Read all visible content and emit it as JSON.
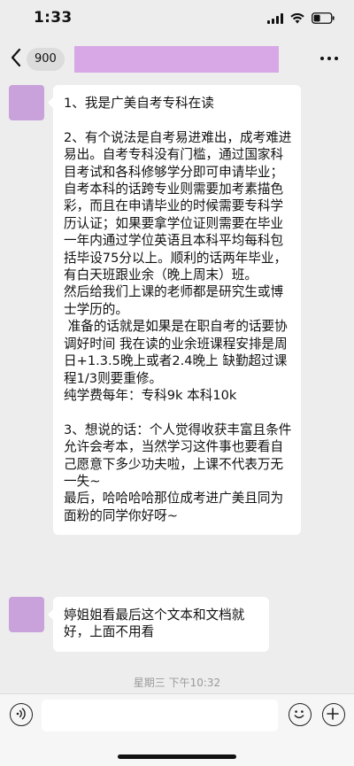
{
  "status_bar": {
    "time": "1:33",
    "icons": [
      "cellular-signal-icon",
      "wifi-icon",
      "battery-icon"
    ]
  },
  "header": {
    "back_icon": "chevron-left-icon",
    "unread_count": "900",
    "title_redacted_color": "#d8a8e6",
    "more_icon": "ellipsis-icon"
  },
  "colors": {
    "background": "#ededed",
    "bubble": "#ffffff",
    "avatar": "#c9a2dc",
    "timestamp_text": "#9a9a9a"
  },
  "messages": [
    {
      "sender": "other",
      "text": "1、我是广美自考专科在读\n\n2、有个说法是自考易进难出，成考难进易出。自考专科没有门槛，通过国家科目考试和各科修够学分即可申请毕业；自考本科的话跨专业则需要加考素描色彩，而且在申请毕业的时候需要专科学历认证；如果要拿学位证则需要在毕业一年内通过学位英语且本科平均每科包括毕设75分以上。顺利的话两年毕业，有白天班跟业余（晚上周末）班。\n然后给我们上课的老师都是研究生或博士学历的。\n 准备的话就是如果是在职自考的话要协调好时间 我在读的业余班课程安排是周日+1.3.5晚上或者2.4晚上 缺勤超过课程1/3则要重修。\n纯学费每年：专科9k 本科10k\n\n3、想说的话：个人觉得收获丰富且条件允许会考本，当然学习这件事也要看自己愿意下多少功夫啦，上课不代表万无一失~\n最后，哈哈哈哈那位成考进广美且同为面粉的同学你好呀~"
    },
    {
      "sender": "other",
      "text": "婷姐姐看最后这个文本和文档就好，上面不用看"
    }
  ],
  "timestamp": "星期三 下午10:32",
  "input_bar": {
    "voice_icon": "voice-icon",
    "emoji_icon": "emoji-icon",
    "plus_icon": "plus-icon",
    "input_value": ""
  }
}
